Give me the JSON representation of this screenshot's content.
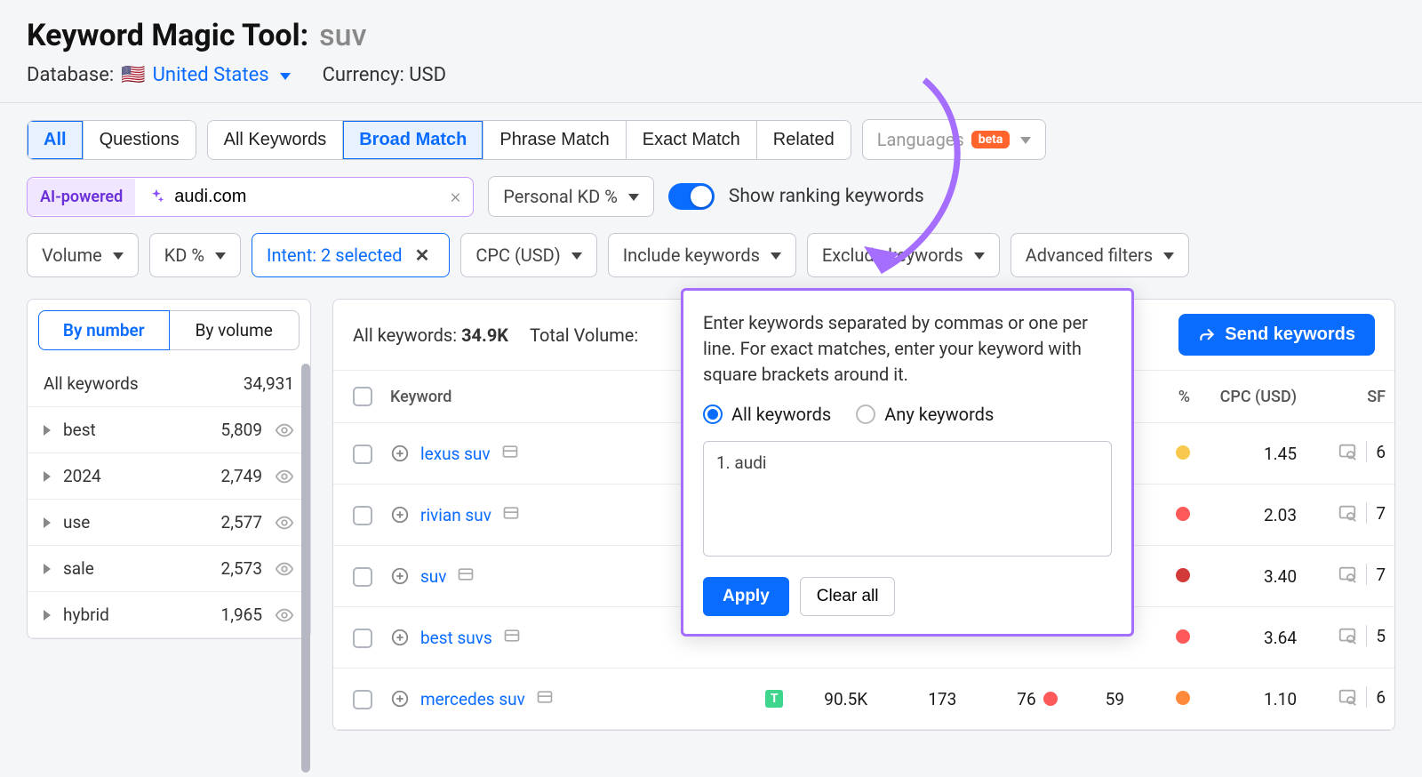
{
  "header": {
    "title": "Keyword Magic Tool:",
    "keyword": "suv",
    "database_label": "Database:",
    "database_value": "United States",
    "flag": "🇺🇸",
    "currency_label": "Currency: USD"
  },
  "tabs_left": {
    "all": "All",
    "questions": "Questions"
  },
  "match_tabs": {
    "all_keywords": "All Keywords",
    "broad": "Broad Match",
    "phrase": "Phrase Match",
    "exact": "Exact Match",
    "related": "Related"
  },
  "lang": {
    "label": "Languages",
    "badge": "beta"
  },
  "ai": {
    "label": "AI-powered",
    "domain": "audi.com"
  },
  "personal_kd": "Personal KD %",
  "ranking_toggle": "Show ranking keywords",
  "filters": {
    "volume": "Volume",
    "kd": "KD %",
    "intent": "Intent: 2 selected",
    "cpc": "CPC (USD)",
    "include": "Include keywords",
    "exclude": "Exclude keywords",
    "advanced": "Advanced filters"
  },
  "sidebar": {
    "tab_number": "By number",
    "tab_volume": "By volume",
    "all_label": "All keywords",
    "all_count": "34,931",
    "items": [
      {
        "label": "best",
        "count": "5,809"
      },
      {
        "label": "2024",
        "count": "2,749"
      },
      {
        "label": "use",
        "count": "2,577"
      },
      {
        "label": "sale",
        "count": "2,573"
      },
      {
        "label": "hybrid",
        "count": "1,965"
      }
    ]
  },
  "stats": {
    "all_label": "All keywords:",
    "all_value": "34.9K",
    "vol_label": "Total Volume:"
  },
  "send_btn": "Send keywords",
  "columns": {
    "keyword": "Keyword",
    "pkd": "%",
    "cpc": "CPC (USD)",
    "sf": "SF"
  },
  "rows": [
    {
      "kw": "lexus suv",
      "cpc": "1.45",
      "sf": "6",
      "dot": "#f8c94e",
      "intent": ""
    },
    {
      "kw": "rivian suv",
      "cpc": "2.03",
      "sf": "7",
      "dot": "#ff5a5a",
      "intent": ""
    },
    {
      "kw": "suv",
      "cpc": "3.40",
      "sf": "7",
      "dot": "#d23a3a",
      "intent": ""
    },
    {
      "kw": "best suvs",
      "cpc": "3.64",
      "sf": "5",
      "dot": "#ff5a5a",
      "intent": ""
    },
    {
      "kw": "mercedes suv",
      "cpc": "1.10",
      "sf": "6",
      "dot": "#ff8a3c",
      "intent": "T",
      "vol": "90.5K",
      "kd": "173",
      "pkd": "76",
      "pct": "59",
      "dot2": "#ff5a5a"
    }
  ],
  "popover": {
    "text": "Enter keywords separated by commas or one per line. For exact matches, enter your keyword with square brackets around it.",
    "radio_all": "All keywords",
    "radio_any": "Any keywords",
    "ta_value": "1. audi",
    "apply": "Apply",
    "clear": "Clear all"
  }
}
